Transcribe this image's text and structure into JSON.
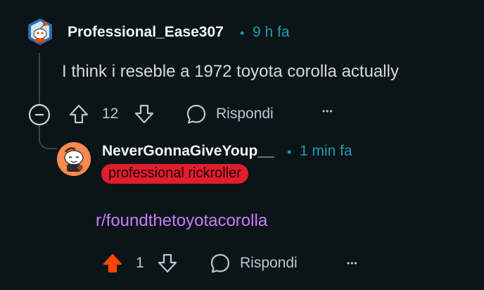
{
  "comment": {
    "username": "Professional_Ease307",
    "separator": "•",
    "time": "9 h fa",
    "body": "I think i reseble a 1972 toyota corolla actually",
    "votes": "12",
    "reply_label": "Rispondi",
    "more_label": "•••"
  },
  "reply": {
    "username": "NeverGonnaGiveYoup__",
    "separator": "•",
    "time": "1 min fa",
    "flair": "professional rickroller",
    "body": "r/foundthetoyotacorolla",
    "votes": "1",
    "reply_label": "Rispondi",
    "more_label": "•••"
  },
  "colors": {
    "background": "#0b1416",
    "upvote_active": "#ff4500",
    "flair_bg": "#e01e2e",
    "link": "#c77dff",
    "timestamp": "#1f9ab8"
  }
}
